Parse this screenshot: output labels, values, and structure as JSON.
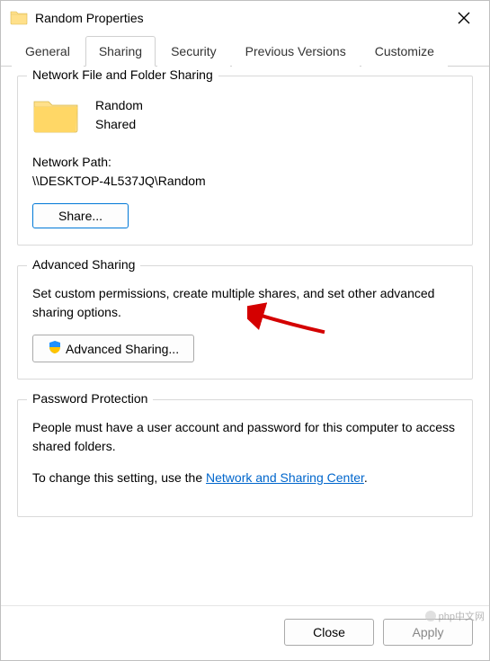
{
  "titlebar": {
    "title": "Random Properties"
  },
  "tabs": {
    "general": "General",
    "sharing": "Sharing",
    "security": "Security",
    "previous": "Previous Versions",
    "customize": "Customize"
  },
  "network_sharing": {
    "group_title": "Network File and Folder Sharing",
    "folder_name": "Random",
    "status": "Shared",
    "path_label": "Network Path:",
    "path_value": "\\\\DESKTOP-4L537JQ\\Random",
    "share_button": "Share..."
  },
  "advanced_sharing": {
    "group_title": "Advanced Sharing",
    "description": "Set custom permissions, create multiple shares, and set other advanced sharing options.",
    "button": "Advanced Sharing..."
  },
  "password_protection": {
    "group_title": "Password Protection",
    "line1": "People must have a user account and password for this computer to access shared folders.",
    "line2_prefix": "To change this setting, use the ",
    "link_text": "Network and Sharing Center",
    "line2_suffix": "."
  },
  "footer": {
    "close": "Close",
    "apply": "Apply"
  },
  "watermark": "php中文网"
}
